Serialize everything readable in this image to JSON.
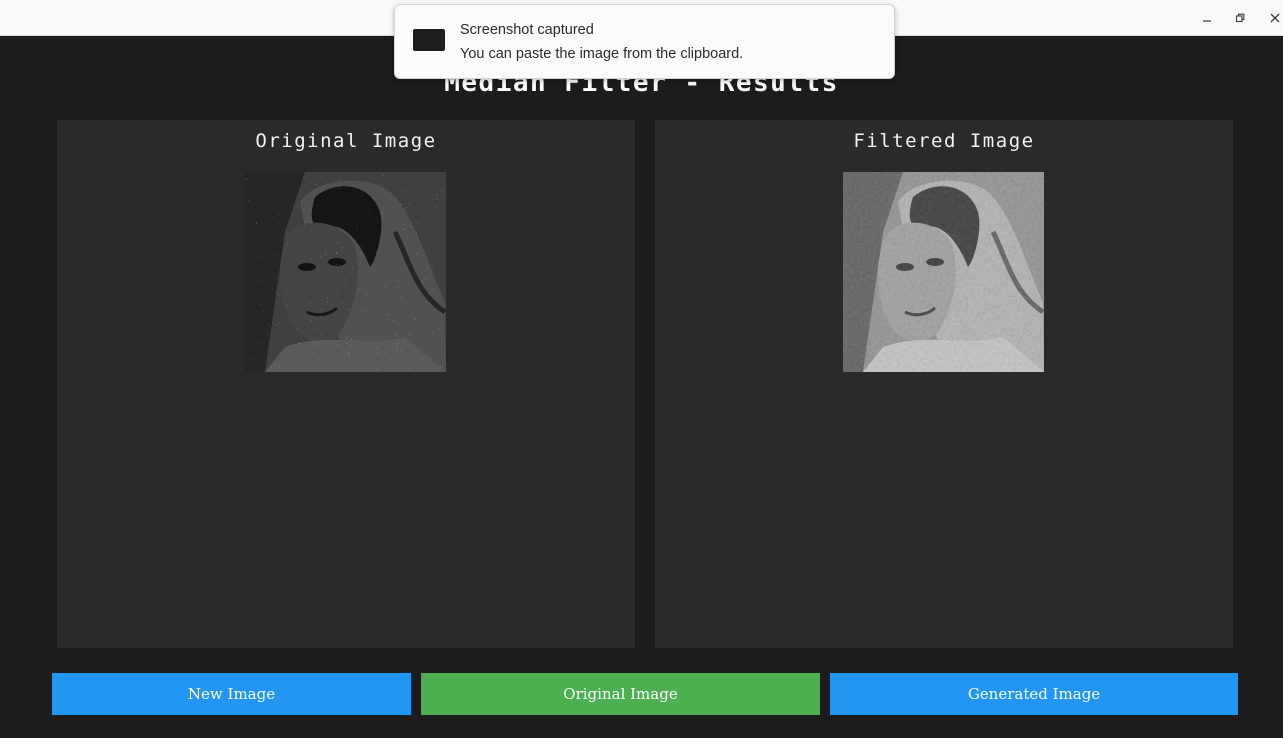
{
  "window": {
    "controls": {
      "minimize": "minimize-icon",
      "restore": "restore-icon",
      "close": "close-icon"
    }
  },
  "app": {
    "title": "Median Filter - Results"
  },
  "panels": [
    {
      "title": "Original Image",
      "image": "noisy-portrait-image"
    },
    {
      "title": "Filtered Image",
      "image": "filtered-portrait-image"
    }
  ],
  "buttons": {
    "new_image": "New Image",
    "original_image": "Original Image",
    "generated_image": "Generated Image"
  },
  "notification": {
    "title": "Screenshot captured",
    "body": "You can paste the image from the clipboard."
  },
  "colors": {
    "background": "#1c1c1c",
    "panel": "#2a2a2a",
    "button_blue": "#2196f3",
    "button_green": "#4caf50",
    "title_text": "#ffffff"
  }
}
